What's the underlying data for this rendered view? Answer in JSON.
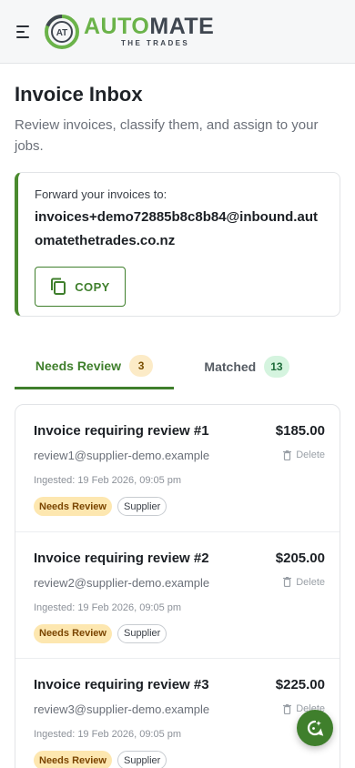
{
  "header": {
    "logo_main_a": "AUTO",
    "logo_main_b": "MATE",
    "logo_sub": "THE TRADES",
    "logo_mark_text": "AT",
    "brand_colors": {
      "green": "#6bb34a",
      "grey": "#3f4650"
    }
  },
  "page": {
    "title": "Invoice Inbox",
    "subtitle": "Review invoices, classify them, and assign to your jobs."
  },
  "forward": {
    "label": "Forward your invoices to:",
    "email": "invoices+demo72885b8c8b84@inbound.automatethetrades.co.nz",
    "copy_label": "COPY",
    "copy_icon": "copy-icon"
  },
  "tabs": [
    {
      "label": "Needs Review",
      "count": "3",
      "active": true
    },
    {
      "label": "Matched",
      "count": "13",
      "active": false
    }
  ],
  "invoices": [
    {
      "title": "Invoice requiring review #1",
      "amount": "$185.00",
      "email": "review1@supplier-demo.example",
      "date": "Ingested: 19 Feb 2026, 09:05 pm",
      "delete_label": "Delete",
      "tags": [
        "Needs Review",
        "Supplier"
      ]
    },
    {
      "title": "Invoice requiring review #2",
      "amount": "$205.00",
      "email": "review2@supplier-demo.example",
      "date": "Ingested: 19 Feb 2026, 09:05 pm",
      "delete_label": "Delete",
      "tags": [
        "Needs Review",
        "Supplier"
      ]
    },
    {
      "title": "Invoice requiring review #3",
      "amount": "$225.00",
      "email": "review3@supplier-demo.example",
      "date": "Ingested: 19 Feb 2026, 09:05 pm",
      "delete_label": "Delete",
      "tags": [
        "Needs Review",
        "Supplier"
      ]
    }
  ],
  "colors": {
    "accent": "#3f7f2c",
    "review_badge": "#fde7b0",
    "matched_badge": "#d5f4df"
  }
}
